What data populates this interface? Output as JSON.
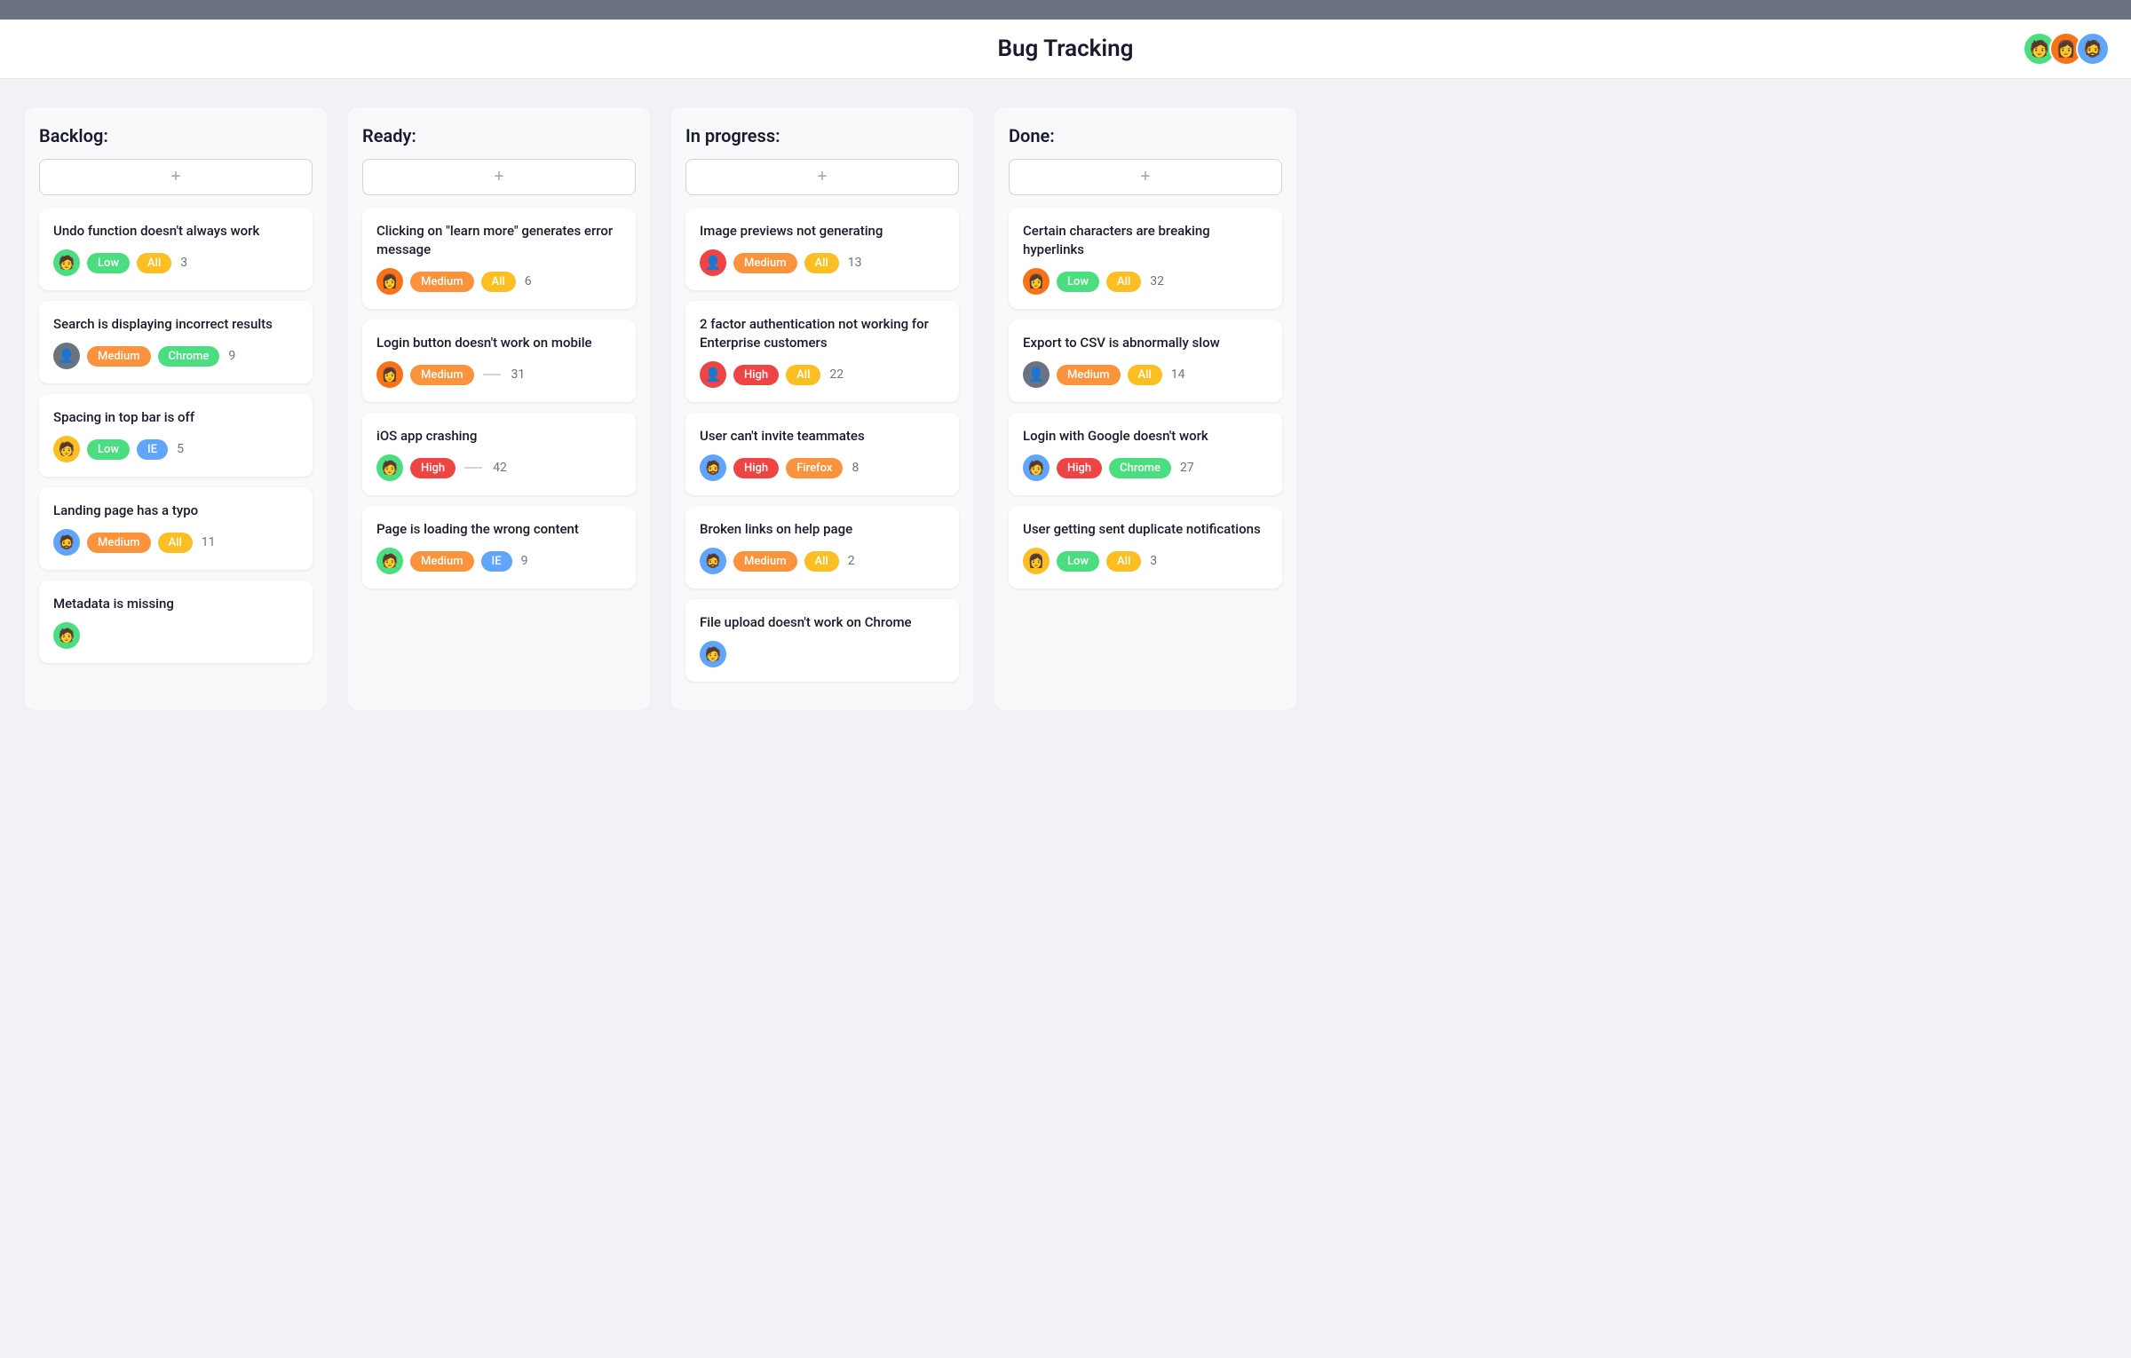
{
  "header": {
    "title": "Bug Tracking",
    "avatars": [
      {
        "id": "avatar-1",
        "emoji": "🧑",
        "color": "#4ade80"
      },
      {
        "id": "avatar-2",
        "emoji": "👩",
        "color": "#f97316"
      },
      {
        "id": "avatar-3",
        "emoji": "🧔",
        "color": "#60a5fa"
      }
    ]
  },
  "columns": [
    {
      "id": "backlog",
      "label": "Backlog:",
      "cards": [
        {
          "title": "Undo function doesn't always work",
          "avatar": "🧑",
          "avatarColor": "#4ade80",
          "priority": "Low",
          "priorityClass": "badge-low",
          "tag": "All",
          "tagClass": "badge-all",
          "count": "3",
          "hasSeparator": false
        },
        {
          "title": "Search is displaying incorrect results",
          "avatar": "👤",
          "avatarColor": "#6b7280",
          "priority": "Medium",
          "priorityClass": "badge-medium",
          "tag": "Chrome",
          "tagClass": "badge-chrome",
          "count": "9",
          "hasSeparator": false
        },
        {
          "title": "Spacing in top bar is off",
          "avatar": "🧑",
          "avatarColor": "#fbbf24",
          "priority": "Low",
          "priorityClass": "badge-low",
          "tag": "IE",
          "tagClass": "badge-ie",
          "count": "5",
          "hasSeparator": false
        },
        {
          "title": "Landing page has a typo",
          "avatar": "🧔",
          "avatarColor": "#60a5fa",
          "priority": "Medium",
          "priorityClass": "badge-medium",
          "tag": "All",
          "tagClass": "badge-all",
          "count": "11",
          "hasSeparator": false
        },
        {
          "title": "Metadata is missing",
          "avatar": "🧑",
          "avatarColor": "#4ade80",
          "priority": "",
          "priorityClass": "",
          "tag": "",
          "tagClass": "",
          "count": "",
          "hasSeparator": false
        }
      ]
    },
    {
      "id": "ready",
      "label": "Ready:",
      "cards": [
        {
          "title": "Clicking on \"learn more\" generates error message",
          "avatar": "👩",
          "avatarColor": "#f97316",
          "priority": "Medium",
          "priorityClass": "badge-medium",
          "tag": "All",
          "tagClass": "badge-all",
          "count": "6",
          "hasSeparator": false
        },
        {
          "title": "Login button doesn't work on mobile",
          "avatar": "👩",
          "avatarColor": "#f97316",
          "priority": "Medium",
          "priorityClass": "badge-medium",
          "tag": "",
          "tagClass": "",
          "count": "31",
          "hasSeparator": true
        },
        {
          "title": "iOS app crashing",
          "avatar": "🧑",
          "avatarColor": "#4ade80",
          "priority": "High",
          "priorityClass": "badge-high",
          "tag": "",
          "tagClass": "",
          "count": "42",
          "hasSeparator": true
        },
        {
          "title": "Page is loading the wrong content",
          "avatar": "🧑",
          "avatarColor": "#4ade80",
          "priority": "Medium",
          "priorityClass": "badge-medium",
          "tag": "IE",
          "tagClass": "badge-ie",
          "count": "9",
          "hasSeparator": false
        }
      ]
    },
    {
      "id": "in-progress",
      "label": "In progress:",
      "cards": [
        {
          "title": "Image previews not generating",
          "avatar": "👤",
          "avatarColor": "#ef4444",
          "priority": "Medium",
          "priorityClass": "badge-medium",
          "tag": "All",
          "tagClass": "badge-all",
          "count": "13",
          "hasSeparator": false
        },
        {
          "title": "2 factor authentication not working for Enterprise customers",
          "avatar": "👤",
          "avatarColor": "#ef4444",
          "priority": "High",
          "priorityClass": "badge-high",
          "tag": "All",
          "tagClass": "badge-all",
          "count": "22",
          "hasSeparator": false
        },
        {
          "title": "User can't invite teammates",
          "avatar": "🧔",
          "avatarColor": "#60a5fa",
          "priority": "High",
          "priorityClass": "badge-high",
          "tag": "Firefox",
          "tagClass": "badge-firefox",
          "count": "8",
          "hasSeparator": false
        },
        {
          "title": "Broken links on help page",
          "avatar": "🧔",
          "avatarColor": "#60a5fa",
          "priority": "Medium",
          "priorityClass": "badge-medium",
          "tag": "All",
          "tagClass": "badge-all",
          "count": "2",
          "hasSeparator": false
        },
        {
          "title": "File upload doesn't work on Chrome",
          "avatar": "🧑",
          "avatarColor": "#60a5fa",
          "priority": "",
          "priorityClass": "",
          "tag": "",
          "tagClass": "",
          "count": "",
          "hasSeparator": false
        }
      ]
    },
    {
      "id": "done",
      "label": "Done:",
      "cards": [
        {
          "title": "Certain characters are breaking hyperlinks",
          "avatar": "👩",
          "avatarColor": "#f97316",
          "priority": "Low",
          "priorityClass": "badge-low",
          "tag": "All",
          "tagClass": "badge-all",
          "count": "32",
          "hasSeparator": false
        },
        {
          "title": "Export to CSV is abnormally slow",
          "avatar": "👤",
          "avatarColor": "#6b7280",
          "priority": "Medium",
          "priorityClass": "badge-medium",
          "tag": "All",
          "tagClass": "badge-all",
          "count": "14",
          "hasSeparator": false
        },
        {
          "title": "Login with Google doesn't work",
          "avatar": "🧑",
          "avatarColor": "#60a5fa",
          "priority": "High",
          "priorityClass": "badge-high",
          "tag": "Chrome",
          "tagClass": "badge-chrome",
          "count": "27",
          "hasSeparator": false
        },
        {
          "title": "User getting sent duplicate notifications",
          "avatar": "👩",
          "avatarColor": "#fbbf24",
          "priority": "Low",
          "priorityClass": "badge-low",
          "tag": "All",
          "tagClass": "badge-all",
          "count": "3",
          "hasSeparator": false
        }
      ]
    }
  ],
  "ui": {
    "add_label": "+",
    "more_label": "..."
  }
}
